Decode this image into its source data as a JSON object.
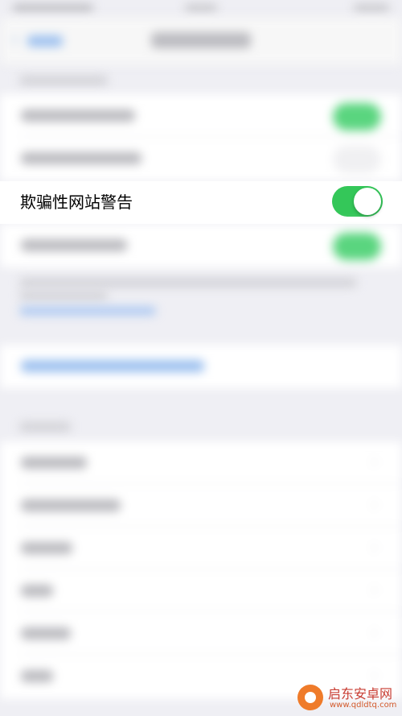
{
  "settings": {
    "fraud_warning_label": "欺骗性网站警告",
    "fraud_warning_enabled": true
  },
  "watermark": {
    "name": "启东安卓网",
    "url": "www.qdldtq.com"
  },
  "colors": {
    "toggle_on": "#34c759",
    "link_blue": "#9cc0ef",
    "background": "#efeff4"
  }
}
